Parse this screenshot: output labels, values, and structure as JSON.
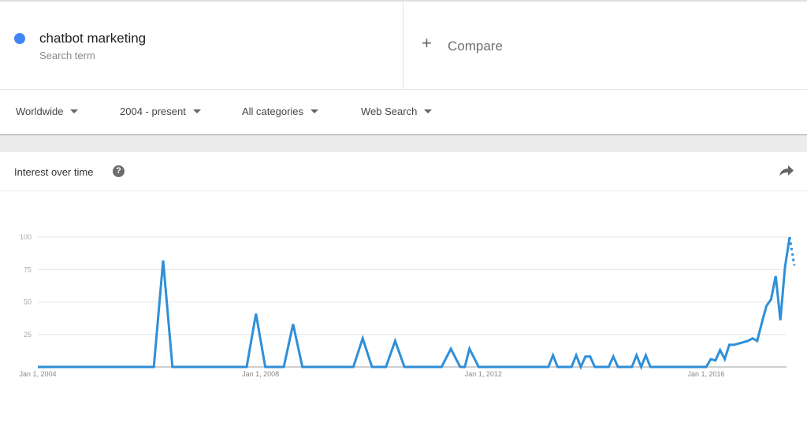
{
  "search_term": {
    "name": "chatbot marketing",
    "subtitle": "Search term",
    "color": "#4285f4"
  },
  "compare": {
    "icon": "plus-icon",
    "label": "Compare"
  },
  "filters": [
    {
      "label": "Worldwide"
    },
    {
      "label": "2004 - present"
    },
    {
      "label": "All categories"
    },
    {
      "label": "Web Search"
    }
  ],
  "panel": {
    "title": "Interest over time",
    "help_icon": "?",
    "share_icon": "share-icon"
  },
  "chart_data": {
    "type": "line",
    "title": "Interest over time",
    "xlabel": "",
    "ylabel": "",
    "ylim": [
      0,
      100
    ],
    "yticks": [
      25,
      50,
      75,
      100
    ],
    "grid": true,
    "line_color": "#2f8fd8",
    "x_tick_labels": [
      "Jan 1, 2004",
      "Jan 1, 2008",
      "Jan 1, 2012",
      "Jan 1, 2016"
    ],
    "x_tick_months": [
      0,
      48,
      96,
      144
    ],
    "x_range_months": [
      0,
      160
    ],
    "x_unit": "months since Jan 2004",
    "series": [
      {
        "name": "chatbot marketing",
        "points": [
          [
            0,
            0
          ],
          [
            25,
            0
          ],
          [
            27,
            82
          ],
          [
            29,
            0
          ],
          [
            45,
            0
          ],
          [
            47,
            41
          ],
          [
            49,
            0
          ],
          [
            53,
            0
          ],
          [
            55,
            33
          ],
          [
            57,
            0
          ],
          [
            68,
            0
          ],
          [
            70,
            22
          ],
          [
            72,
            0
          ],
          [
            75,
            0
          ],
          [
            77,
            20
          ],
          [
            79,
            0
          ],
          [
            87,
            0
          ],
          [
            89,
            14
          ],
          [
            91,
            0
          ],
          [
            92,
            0
          ],
          [
            93,
            14
          ],
          [
            95,
            0
          ],
          [
            110,
            0
          ],
          [
            111,
            9
          ],
          [
            112,
            0
          ],
          [
            115,
            0
          ],
          [
            116,
            9
          ],
          [
            117,
            0
          ],
          [
            118,
            8
          ],
          [
            119,
            8
          ],
          [
            120,
            0
          ],
          [
            123,
            0
          ],
          [
            124,
            8
          ],
          [
            125,
            0
          ],
          [
            128,
            0
          ],
          [
            129,
            9
          ],
          [
            130,
            0
          ],
          [
            131,
            9
          ],
          [
            132,
            0
          ],
          [
            144,
            0
          ],
          [
            145,
            6
          ],
          [
            146,
            5
          ],
          [
            147,
            13
          ],
          [
            148,
            6
          ],
          [
            149,
            17
          ],
          [
            150,
            17
          ],
          [
            151,
            18
          ],
          [
            152,
            19
          ],
          [
            153,
            20
          ],
          [
            154,
            22
          ],
          [
            155,
            20
          ],
          [
            156,
            34
          ],
          [
            157,
            47
          ],
          [
            158,
            52
          ],
          [
            159,
            70
          ],
          [
            160,
            36
          ],
          [
            161,
            77
          ],
          [
            162,
            100
          ]
        ],
        "partial_points": [
          [
            162,
            100
          ],
          [
            163,
            78
          ]
        ]
      }
    ]
  }
}
